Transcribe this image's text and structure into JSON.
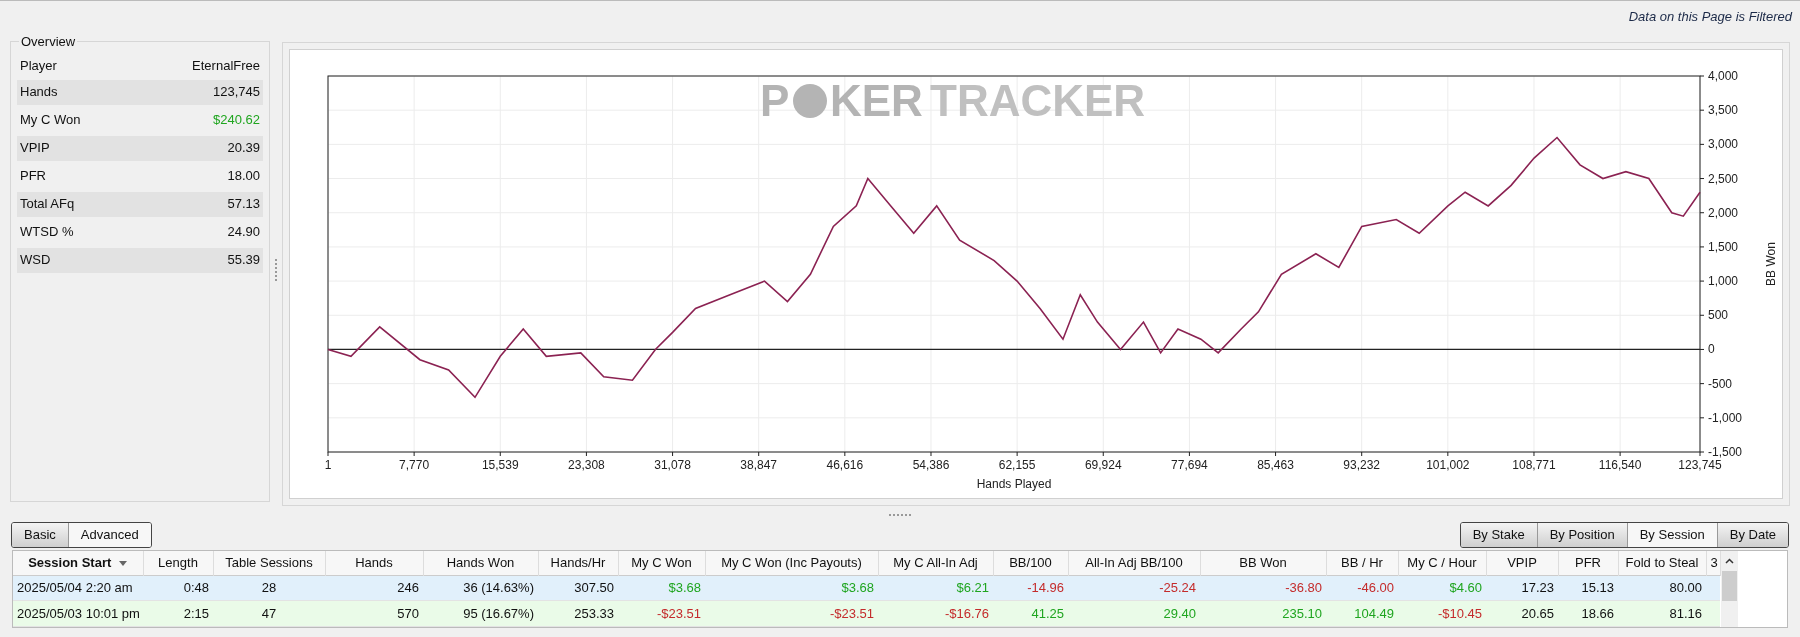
{
  "filter_notice": "Data on this Page is Filtered",
  "overview": {
    "title": "Overview",
    "header": {
      "label": "Player",
      "value": "EternalFree"
    },
    "rows": [
      {
        "label": "Hands",
        "value": "123,745",
        "color": "#111111"
      },
      {
        "label": "My C Won",
        "value": "$240.62",
        "color": "#1fa51f"
      },
      {
        "label": "VPIP",
        "value": "20.39",
        "color": "#111111"
      },
      {
        "label": "PFR",
        "value": "18.00",
        "color": "#111111"
      },
      {
        "label": "Total AFq",
        "value": "57.13",
        "color": "#111111"
      },
      {
        "label": "WTSD %",
        "value": "24.90",
        "color": "#111111"
      },
      {
        "label": "WSD",
        "value": "55.39",
        "color": "#111111"
      }
    ]
  },
  "graph": {
    "logo": {
      "before": "P",
      "after": "KER",
      "tail": "TRACKER"
    },
    "chart_data": {
      "type": "line",
      "grid": true,
      "xlabel": "Hands Played",
      "ylabel": "BB Won",
      "x": [
        1,
        2073,
        4663,
        8290,
        10880,
        13260,
        15540,
        17610,
        19690,
        22800,
        24870,
        27460,
        29530,
        31080,
        33150,
        36260,
        39370,
        41440,
        43510,
        45580,
        47650,
        48690,
        50760,
        52830,
        54900,
        56970,
        60080,
        62150,
        64220,
        66290,
        67850,
        69400,
        71480,
        73550,
        75100,
        76660,
        78730,
        80290,
        82360,
        83920,
        85990,
        89100,
        91170,
        93240,
        96350,
        98420,
        101010,
        102560,
        104640,
        106710,
        108780,
        110850,
        112920,
        114990,
        117060,
        119130,
        121200,
        122240,
        123745
      ],
      "series": [
        {
          "color": "#8b2252",
          "values": [
            0,
            -100,
            330,
            -150,
            -300,
            -700,
            -100,
            300,
            -100,
            -50,
            -400,
            -450,
            0,
            250,
            600,
            800,
            1000,
            700,
            1100,
            1800,
            2100,
            2500,
            2100,
            1700,
            2100,
            1600,
            1300,
            1000,
            600,
            150,
            800,
            400,
            0,
            400,
            -50,
            300,
            150,
            -50,
            300,
            550,
            1100,
            1400,
            1200,
            1800,
            1900,
            1700,
            2100,
            2300,
            2100,
            2400,
            2800,
            3100,
            2700,
            2500,
            2600,
            2500,
            2000,
            1950,
            2300
          ]
        }
      ],
      "xlim": [
        1,
        123745
      ],
      "ylim": [
        -1500,
        4000
      ],
      "xticks": [
        {
          "value": 1,
          "label": "1"
        },
        {
          "value": 7770,
          "label": "7,770"
        },
        {
          "value": 15539,
          "label": "15,539"
        },
        {
          "value": 23308,
          "label": "23,308"
        },
        {
          "value": 31078,
          "label": "31,078"
        },
        {
          "value": 38847,
          "label": "38,847"
        },
        {
          "value": 46616,
          "label": "46,616"
        },
        {
          "value": 54386,
          "label": "54,386"
        },
        {
          "value": 62155,
          "label": "62,155"
        },
        {
          "value": 69924,
          "label": "69,924"
        },
        {
          "value": 77694,
          "label": "77,694"
        },
        {
          "value": 85463,
          "label": "85,463"
        },
        {
          "value": 93232,
          "label": "93,232"
        },
        {
          "value": 101002,
          "label": "101,002"
        },
        {
          "value": 108771,
          "label": "108,771"
        },
        {
          "value": 116540,
          "label": "116,540"
        },
        {
          "value": 123745,
          "label": "123,745"
        }
      ],
      "yticks": [
        {
          "value": 4000,
          "label": "4,000"
        },
        {
          "value": 3500,
          "label": "3,500"
        },
        {
          "value": 3000,
          "label": "3,000"
        },
        {
          "value": 2500,
          "label": "2,500"
        },
        {
          "value": 2000,
          "label": "2,000"
        },
        {
          "value": 1500,
          "label": "1,500"
        },
        {
          "value": 1000,
          "label": "1,000"
        },
        {
          "value": 500,
          "label": "500"
        },
        {
          "value": 0,
          "label": "0"
        },
        {
          "value": -500,
          "label": "-500"
        },
        {
          "value": -1000,
          "label": "-1,000"
        },
        {
          "value": -1500,
          "label": "-1,500"
        }
      ]
    }
  },
  "view_tabs": [
    {
      "label": "Basic",
      "selected": false
    },
    {
      "label": "Advanced",
      "selected": true
    }
  ],
  "group_tabs": [
    {
      "label": "By Stake",
      "selected": false
    },
    {
      "label": "By Position",
      "selected": false
    },
    {
      "label": "By Session",
      "selected": true
    },
    {
      "label": "By Date",
      "selected": false
    }
  ],
  "table": {
    "columns": [
      {
        "label": "Session Start",
        "sorted": true
      },
      {
        "label": "Length",
        "sorted": false
      },
      {
        "label": "Table Sessions",
        "sorted": false
      },
      {
        "label": "Hands",
        "sorted": false
      },
      {
        "label": "Hands Won",
        "sorted": false
      },
      {
        "label": "Hands/Hr",
        "sorted": false
      },
      {
        "label": "My C Won",
        "sorted": false
      },
      {
        "label": "My C Won (Inc Payouts)",
        "sorted": false
      },
      {
        "label": "My C All-In Adj",
        "sorted": false
      },
      {
        "label": "BB/100",
        "sorted": false
      },
      {
        "label": "All-In Adj BB/100",
        "sorted": false
      },
      {
        "label": "BB Won",
        "sorted": false
      },
      {
        "label": "BB / Hr",
        "sorted": false
      },
      {
        "label": "My C / Hour",
        "sorted": false
      },
      {
        "label": "VPIP",
        "sorted": false
      },
      {
        "label": "PFR",
        "sorted": false
      },
      {
        "label": "Fold to Steal",
        "sorted": false
      },
      {
        "label": "3",
        "sorted": false
      }
    ],
    "rows": [
      {
        "selected": true,
        "cells": [
          {
            "text": "2025/05/04  2:20 am",
            "color": "#111111"
          },
          {
            "text": "0:48",
            "color": "#111111"
          },
          {
            "text": "28",
            "color": "#111111"
          },
          {
            "text": "246",
            "color": "#111111"
          },
          {
            "text": "36 (14.63%)",
            "color": "#111111"
          },
          {
            "text": "307.50",
            "color": "#111111"
          },
          {
            "text": "$3.68",
            "color": "#1fa51f"
          },
          {
            "text": "$3.68",
            "color": "#1fa51f"
          },
          {
            "text": "$6.21",
            "color": "#1fa51f"
          },
          {
            "text": "-14.96",
            "color": "#c42b2b"
          },
          {
            "text": "-25.24",
            "color": "#c42b2b"
          },
          {
            "text": "-36.80",
            "color": "#c42b2b"
          },
          {
            "text": "-46.00",
            "color": "#c42b2b"
          },
          {
            "text": "$4.60",
            "color": "#1fa51f"
          },
          {
            "text": "17.23",
            "color": "#111111"
          },
          {
            "text": "15.13",
            "color": "#111111"
          },
          {
            "text": "80.00",
            "color": "#111111"
          }
        ]
      },
      {
        "selected": false,
        "cells": [
          {
            "text": "2025/05/03 10:01 pm",
            "color": "#111111"
          },
          {
            "text": "2:15",
            "color": "#111111"
          },
          {
            "text": "47",
            "color": "#111111"
          },
          {
            "text": "570",
            "color": "#111111"
          },
          {
            "text": "95 (16.67%)",
            "color": "#111111"
          },
          {
            "text": "253.33",
            "color": "#111111"
          },
          {
            "text": "-$23.51",
            "color": "#c42b2b"
          },
          {
            "text": "-$23.51",
            "color": "#c42b2b"
          },
          {
            "text": "-$16.76",
            "color": "#c42b2b"
          },
          {
            "text": "41.25",
            "color": "#1fa51f"
          },
          {
            "text": "29.40",
            "color": "#1fa51f"
          },
          {
            "text": "235.10",
            "color": "#1fa51f"
          },
          {
            "text": "104.49",
            "color": "#1fa51f"
          },
          {
            "text": "-$10.45",
            "color": "#c42b2b"
          },
          {
            "text": "20.65",
            "color": "#111111"
          },
          {
            "text": "18.66",
            "color": "#111111"
          },
          {
            "text": "81.16",
            "color": "#111111"
          }
        ]
      }
    ]
  }
}
